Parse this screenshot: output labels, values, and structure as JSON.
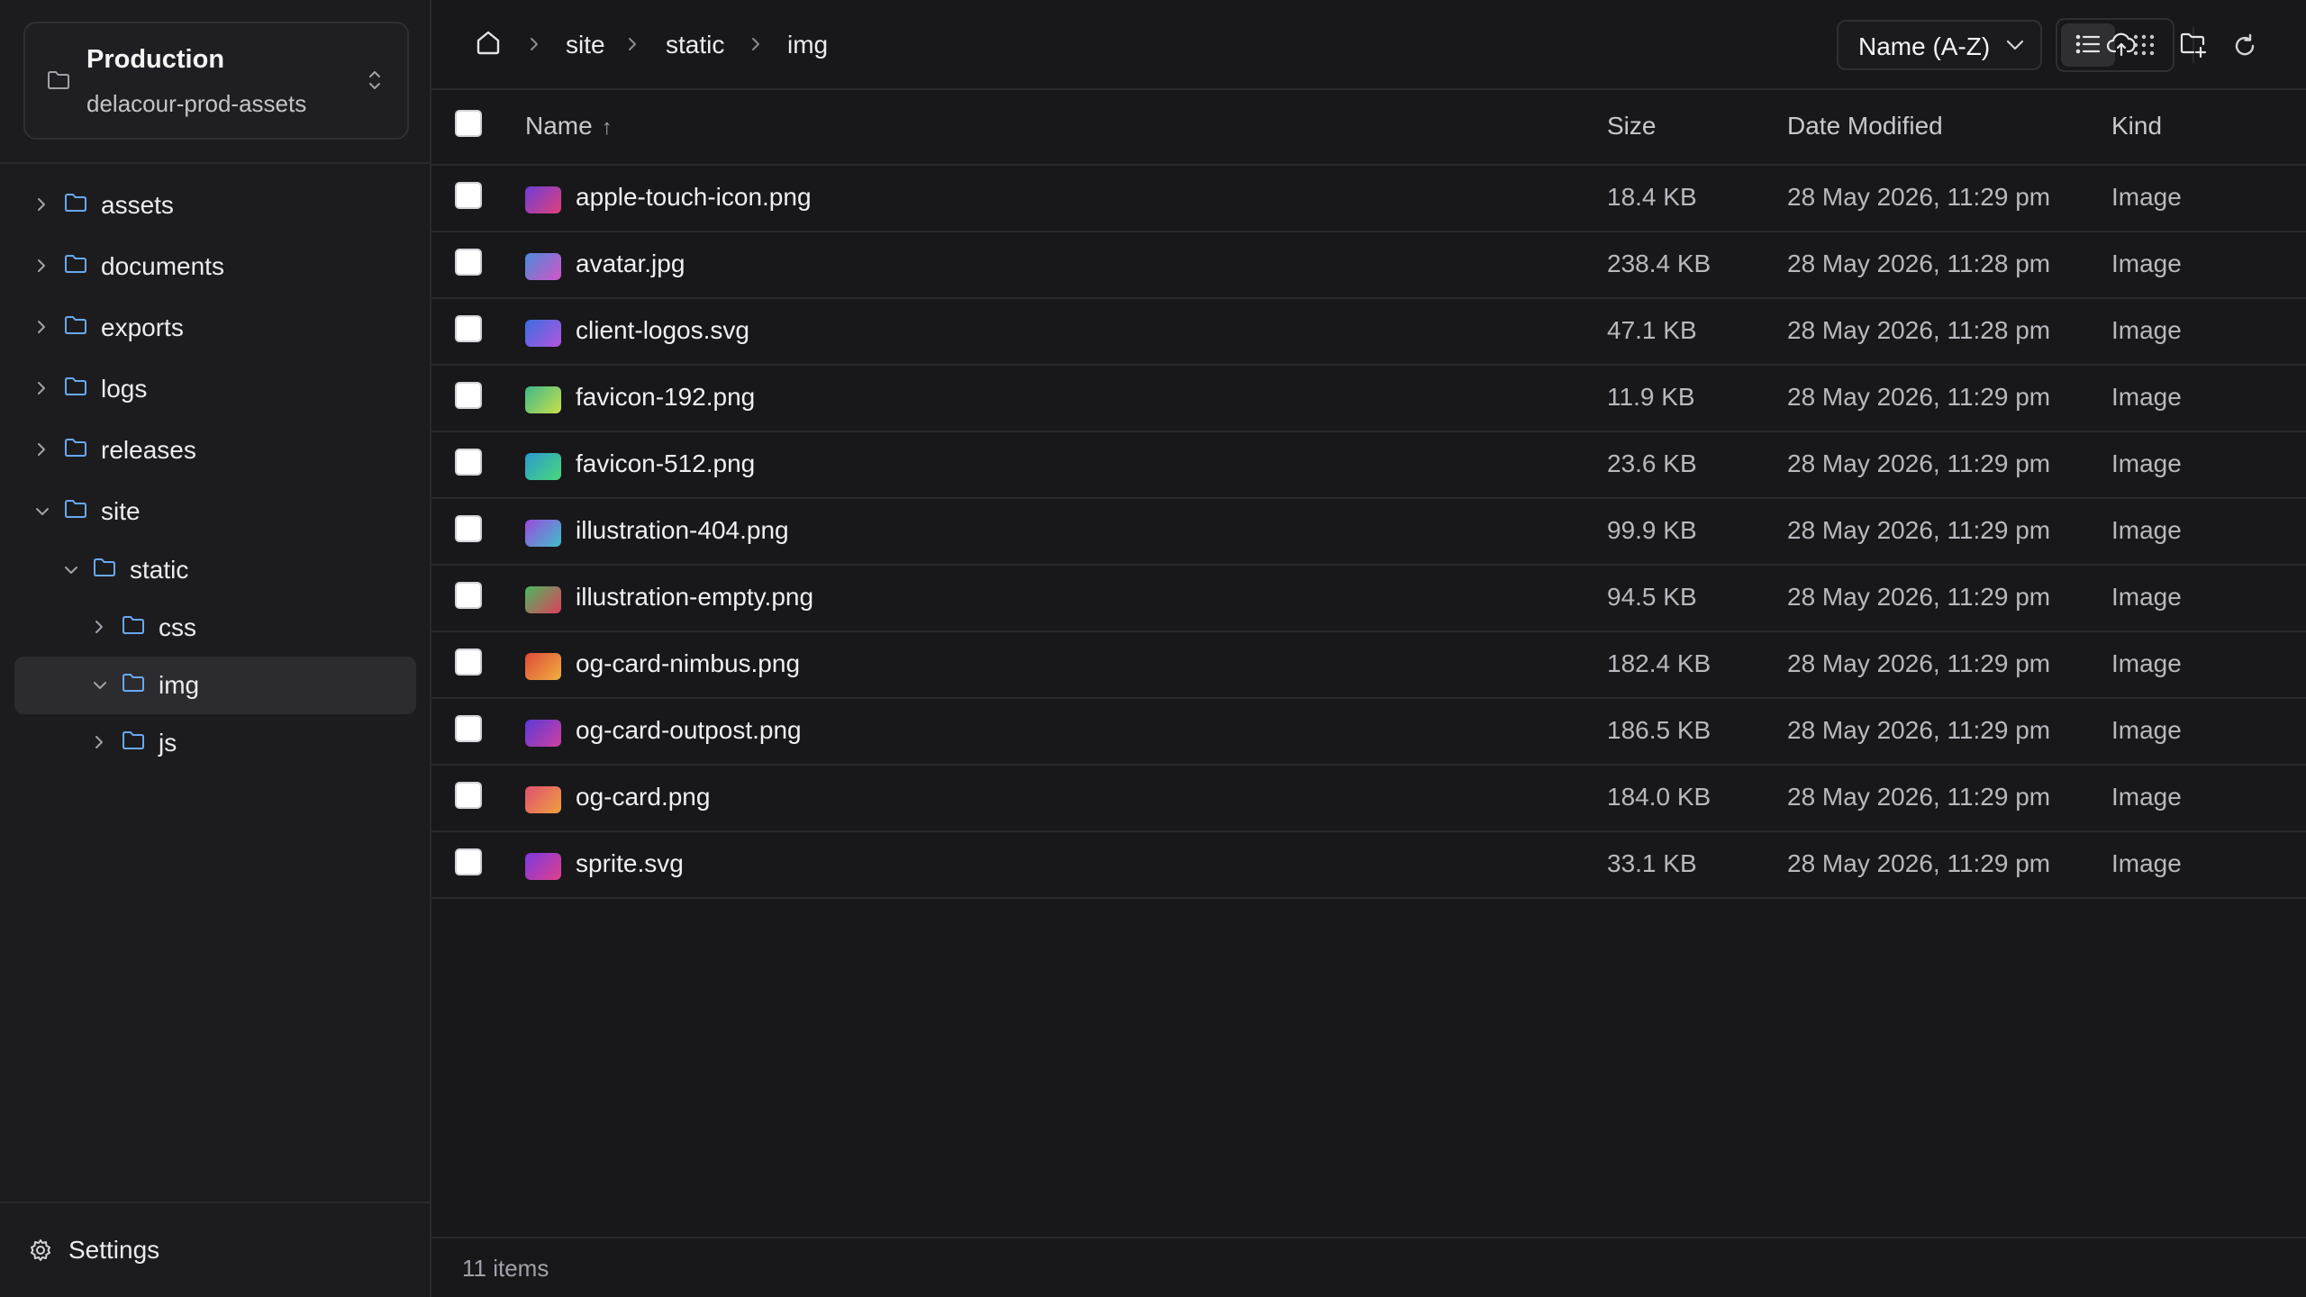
{
  "sidebar": {
    "bucket": {
      "name": "Production",
      "id": "delacour-prod-assets"
    },
    "tree": [
      {
        "label": "assets",
        "expanded": false
      },
      {
        "label": "documents",
        "expanded": false
      },
      {
        "label": "exports",
        "expanded": false
      },
      {
        "label": "logs",
        "expanded": false
      },
      {
        "label": "releases",
        "expanded": false
      },
      {
        "label": "site",
        "expanded": true
      },
      {
        "label": "static",
        "expanded": true
      },
      {
        "label": "css",
        "expanded": false
      },
      {
        "label": "img",
        "expanded": true,
        "selected": true
      },
      {
        "label": "js",
        "expanded": false
      }
    ],
    "settings_label": "Settings"
  },
  "breadcrumb": [
    "site",
    "static",
    "img"
  ],
  "toolbar": {
    "upload_icon": "cloud-upload-icon",
    "new_folder_icon": "folder-plus-icon",
    "sort_label": "Name (A-Z)",
    "view_mode": "list",
    "refresh_icon": "refresh-icon"
  },
  "table": {
    "columns": {
      "name": "Name",
      "sort_arrow": "↑",
      "size": "Size",
      "date": "Date Modified",
      "kind": "Kind"
    },
    "rows": [
      {
        "name": "apple-touch-icon.png",
        "size": "18.4 KB",
        "date": "28 May 2026, 11:29 pm",
        "kind": "Image",
        "thumb": [
          "#6d3fd6",
          "#e0407a"
        ]
      },
      {
        "name": "avatar.jpg",
        "size": "238.4 KB",
        "date": "28 May 2026, 11:28 pm",
        "kind": "Image",
        "thumb": [
          "#4a8ad8",
          "#d455c8"
        ]
      },
      {
        "name": "client-logos.svg",
        "size": "47.1 KB",
        "date": "28 May 2026, 11:28 pm",
        "kind": "Image",
        "thumb": [
          "#3a6ee0",
          "#b455e0"
        ]
      },
      {
        "name": "favicon-192.png",
        "size": "11.9 KB",
        "date": "28 May 2026, 11:29 pm",
        "kind": "Image",
        "thumb": [
          "#3fb88a",
          "#c8e04a"
        ]
      },
      {
        "name": "favicon-512.png",
        "size": "23.6 KB",
        "date": "28 May 2026, 11:29 pm",
        "kind": "Image",
        "thumb": [
          "#2a9ad0",
          "#4ad878"
        ]
      },
      {
        "name": "illustration-404.png",
        "size": "99.9 KB",
        "date": "28 May 2026, 11:29 pm",
        "kind": "Image",
        "thumb": [
          "#9a4ae0",
          "#40c0c8"
        ]
      },
      {
        "name": "illustration-empty.png",
        "size": "94.5 KB",
        "date": "28 May 2026, 11:29 pm",
        "kind": "Image",
        "thumb": [
          "#4ab860",
          "#e0405a"
        ]
      },
      {
        "name": "og-card-nimbus.png",
        "size": "182.4 KB",
        "date": "28 May 2026, 11:29 pm",
        "kind": "Image",
        "thumb": [
          "#e04a3a",
          "#f0b040"
        ]
      },
      {
        "name": "og-card-outpost.png",
        "size": "186.5 KB",
        "date": "28 May 2026, 11:29 pm",
        "kind": "Image",
        "thumb": [
          "#5a3ad8",
          "#d040a0"
        ]
      },
      {
        "name": "og-card.png",
        "size": "184.0 KB",
        "date": "28 May 2026, 11:29 pm",
        "kind": "Image",
        "thumb": [
          "#e05070",
          "#f0a040"
        ]
      },
      {
        "name": "sprite.svg",
        "size": "33.1 KB",
        "date": "28 May 2026, 11:29 pm",
        "kind": "Image",
        "thumb": [
          "#7a3ae0",
          "#e0408a"
        ]
      }
    ]
  },
  "footer": {
    "count": "11 items"
  },
  "colors": {
    "background": "#18181b",
    "sidebar": "#1c1c1f",
    "border": "#2a2a2e",
    "selected": "#2b2b30"
  }
}
